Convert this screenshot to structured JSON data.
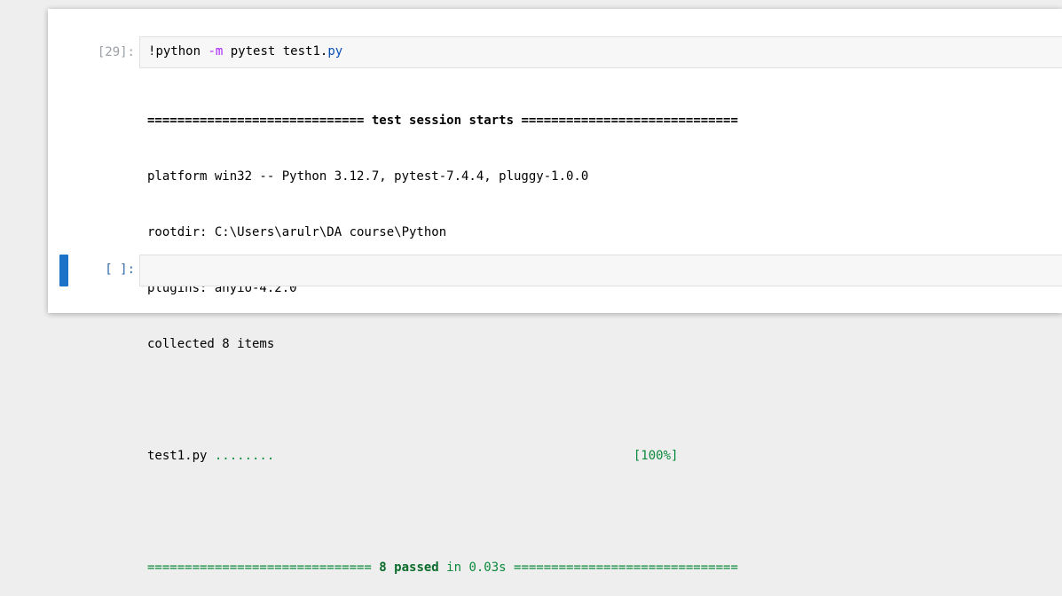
{
  "cell1": {
    "prompt": "[29]:",
    "code": {
      "bang": "!",
      "cmd": "python ",
      "flag": "-m",
      "rest": " pytest test1.",
      "ext": "py"
    },
    "output": {
      "header_left": "============================= ",
      "header_title": "test session starts",
      "header_right": " =============================",
      "platform": "platform win32 -- Python 3.12.7, pytest-7.4.4, pluggy-1.0.0",
      "rootdir": "rootdir: C:\\Users\\arulr\\DA course\\Python",
      "plugins": "plugins: anyio-4.2.0",
      "collected": "collected 8 items",
      "test_file": "test1.py ",
      "test_dots": "........",
      "test_pad": "                                                ",
      "test_percent": "[100%]",
      "summary_left": "============================== ",
      "summary_passed": "8 passed",
      "summary_in": " in 0.03s",
      "summary_right": " =============================="
    }
  },
  "cell2": {
    "prompt": "[ ]:"
  },
  "colors": {
    "active_bar": "#1a73c8",
    "pass_green": "#0b8a3c",
    "operator_purple": "#aa22ff",
    "background": "#eeeeee"
  }
}
